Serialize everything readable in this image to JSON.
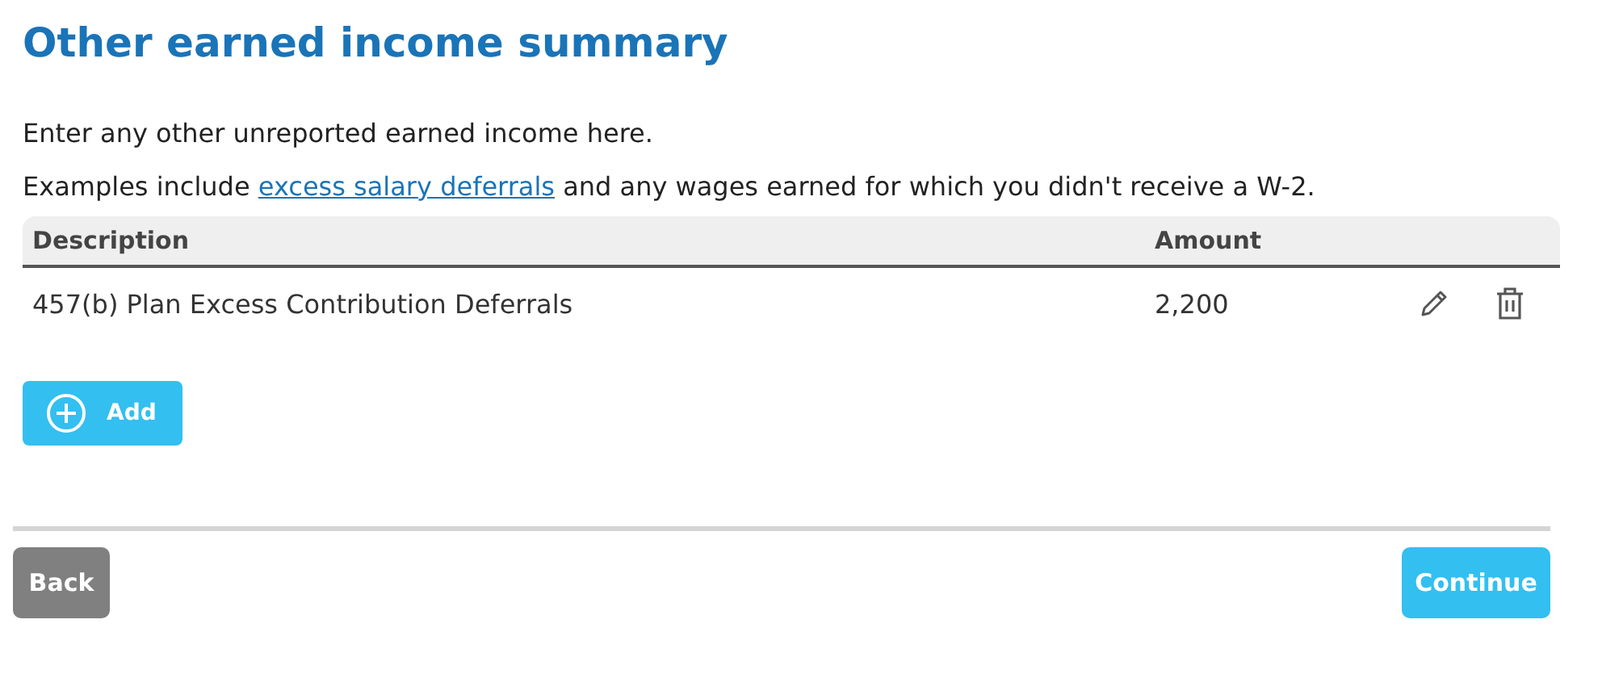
{
  "title": "Other earned income summary",
  "intro": "Enter any other unreported earned income here.",
  "examples": {
    "before": "Examples include",
    "link": "excess salary deferrals",
    "after": "and any wages earned for which you didn't receive a W-2."
  },
  "table": {
    "columns": [
      "Description",
      "Amount"
    ],
    "rows": [
      {
        "description": "457(b) Plan Excess Contribution Deferrals",
        "amount": "2,200"
      }
    ]
  },
  "add_button": "Add",
  "buttons": {
    "back": "Back",
    "continue": "Continue"
  }
}
